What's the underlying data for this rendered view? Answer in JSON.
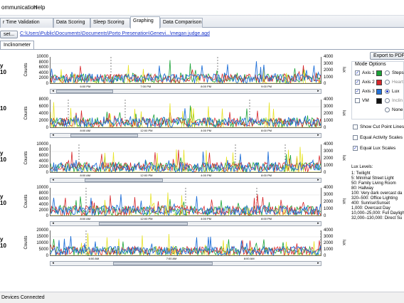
{
  "menu": [
    "ommunication",
    "Help"
  ],
  "tabs": [
    {
      "label": "r Time Validation",
      "active": false
    },
    {
      "label": "Data Scoring",
      "active": false
    },
    {
      "label": "Sleep Scoring",
      "active": false
    },
    {
      "label": "Graphing",
      "active": true
    },
    {
      "label": "Data Comparison",
      "active": false
    }
  ],
  "toolbar": {
    "reset_label": "set...",
    "file_path": "C:\\Users\\Public\\Documents\\Documents\\Porto Presenation\\Genevi...\\megan judge.agd"
  },
  "subtab": "Inclinometer",
  "right_panel": {
    "export_label": "Export to PDF...",
    "mode_title": "Mode Options",
    "axes": [
      {
        "label": "Axis 1",
        "checked": true,
        "color": "#1aa336"
      },
      {
        "label": "Axis 2",
        "checked": true,
        "color": "#d7262a"
      },
      {
        "label": "Axis 3",
        "checked": true,
        "color": "#2372d9"
      },
      {
        "label": "VM",
        "checked": false,
        "color": "#111111"
      }
    ],
    "modes": [
      {
        "label": "Steps",
        "selected": false,
        "muted": false
      },
      {
        "label": "Heart",
        "selected": false,
        "muted": true
      },
      {
        "label": "Lux",
        "selected": true,
        "muted": false
      },
      {
        "label": "Inclin",
        "selected": false,
        "muted": true
      },
      {
        "label": "None",
        "selected": false,
        "muted": false
      }
    ],
    "options": [
      {
        "label": "Show Cut Point Lines",
        "checked": false
      },
      {
        "label": "Equal Activity Scales",
        "checked": false
      },
      {
        "label": "Equal Lux Scales",
        "checked": true
      }
    ],
    "lux_levels_title": "Lux Levels:",
    "lux_levels": [
      "1: Twilight",
      "5: Minimal Street Light",
      "50: Family Living Room",
      "80: Hallway",
      "100: Very dark overcast da",
      "320–500: Office Lighting",
      "400: Sunrise\\Sunset",
      "1,000: Overcast Day",
      "10,000–25,000: Full Dayligh",
      "32,000–130,000: Direct Su"
    ]
  },
  "rows": [
    {
      "label1": "y",
      "label2": "10",
      "ylabel": "Counts",
      "ylabel_right": "lux",
      "yticks": [
        "10000",
        "8000",
        "6000",
        "4000",
        "2000",
        "0"
      ],
      "yticks_right": [
        "4000",
        "3000",
        "2000",
        "1000",
        "0"
      ],
      "xticks": [
        "6:00 PM",
        "7:00 PM",
        "8:00 PM",
        "9:00 PM"
      ]
    },
    {
      "label1": "",
      "label2": "10",
      "ylabel": "Counts",
      "ylabel_right": "lux",
      "yticks": [
        "8000",
        "6000",
        "4000",
        "2000",
        "0"
      ],
      "yticks_right": [
        "4000",
        "3000",
        "2000",
        "1000",
        "0"
      ],
      "xticks": [
        "8:00 AM",
        "12:00 PM",
        "4:00 PM",
        "8:00 PM"
      ]
    },
    {
      "label1": "y",
      "label2": "10",
      "ylabel": "Counts",
      "ylabel_right": "lux",
      "yticks": [
        "10000",
        "8000",
        "6000",
        "4000",
        "2000",
        "0"
      ],
      "yticks_right": [
        "4000",
        "3000",
        "2000",
        "1000",
        "0"
      ],
      "xticks": [
        "8:00 AM",
        "12:00 PM",
        "4:00 PM",
        "8:00 PM"
      ]
    },
    {
      "label1": "y",
      "label2": "10",
      "ylabel": "Counts",
      "ylabel_right": "lux",
      "yticks": [
        "10000",
        "8000",
        "6000",
        "4000",
        "2000",
        "0"
      ],
      "yticks_right": [
        "4000",
        "3000",
        "2000",
        "1000",
        "0"
      ],
      "xticks": [
        "8:00 AM",
        "12:00 PM",
        "4:00 PM",
        "8:00 PM"
      ]
    },
    {
      "label1": "y",
      "label2": "10",
      "ylabel": "Counts",
      "ylabel_right": "lux",
      "yticks": [
        "20000",
        "15000",
        "10000",
        "5000",
        "0"
      ],
      "yticks_right": [
        "4000",
        "3000",
        "2000",
        "1000",
        "0"
      ],
      "xticks": [
        "6:00 AM",
        "7:00 AM",
        "8:00 AM"
      ]
    }
  ],
  "status": "Devices Connected"
}
